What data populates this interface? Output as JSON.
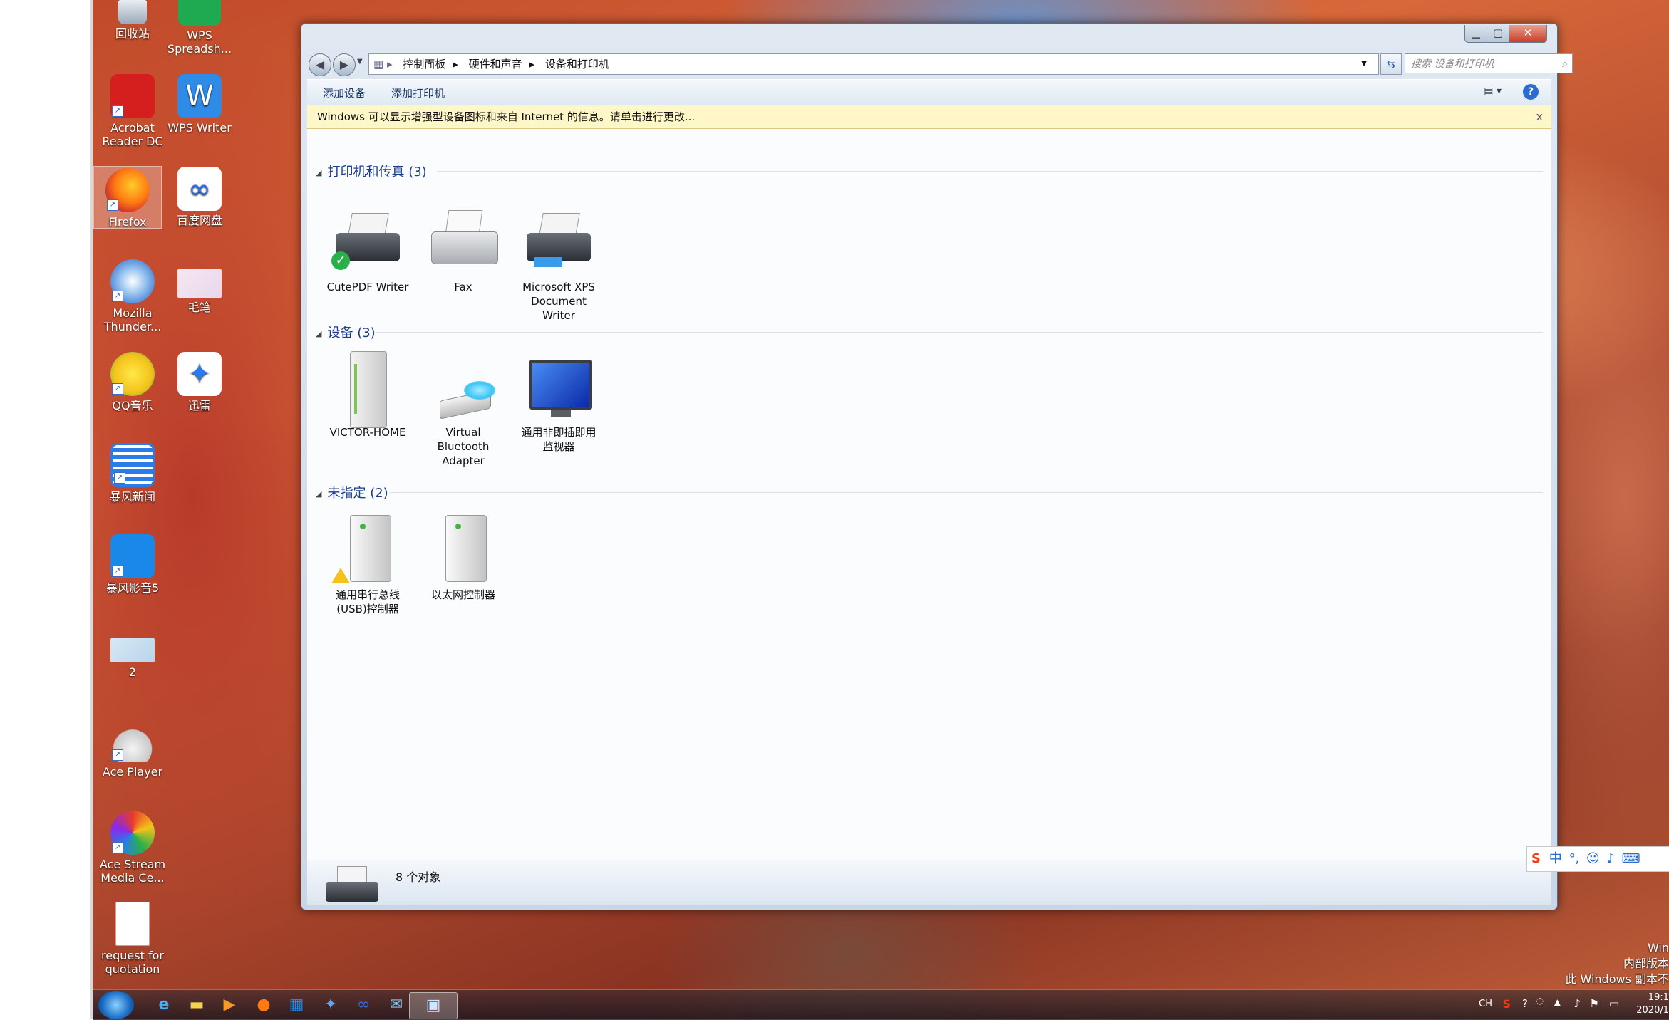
{
  "desktop": {
    "icons": [
      {
        "label": "回收站"
      },
      {
        "label": "WPS\nSpreadsh..."
      },
      {
        "label": "Acrobat\nReader DC"
      },
      {
        "label": "WPS Writer"
      },
      {
        "label": "Firefox"
      },
      {
        "label": "百度网盘"
      },
      {
        "label": "Mozilla\nThunder..."
      },
      {
        "label": "毛笔"
      },
      {
        "label": "QQ音乐"
      },
      {
        "label": "迅雷"
      },
      {
        "label": "暴风新闻"
      },
      {
        "label": "暴风影音5"
      },
      {
        "label": "2"
      },
      {
        "label": "Ace Player"
      },
      {
        "label": "Ace Stream\nMedia Ce..."
      },
      {
        "label": "request for\nquotation"
      }
    ]
  },
  "window": {
    "address": [
      "控制面板",
      "硬件和声音",
      "设备和打印机"
    ],
    "search_placeholder": "搜索 设备和打印机",
    "toolbar": {
      "add_device": "添加设备",
      "add_printer": "添加打印机"
    },
    "infobar": "Windows 可以显示增强型设备图标和来自 Internet 的信息。请单击进行更改...",
    "groups": [
      {
        "header": "打印机和传真 (3)",
        "devices": [
          "CutePDF Writer",
          "Fax",
          "Microsoft XPS\nDocument\nWriter"
        ]
      },
      {
        "header": "设备 (3)",
        "devices": [
          "VICTOR-HOME",
          "Virtual\nBluetooth\nAdapter",
          "通用非即插即用\n监视器"
        ]
      },
      {
        "header": "未指定 (2)",
        "devices": [
          "通用串行总线\n(USB)控制器",
          "以太网控制器"
        ]
      }
    ],
    "details": "8 个对象"
  },
  "taskbar": {
    "tray": {
      "lang": "CH",
      "time": "19:1",
      "date": "2020/1"
    }
  },
  "watermark": [
    "Win",
    "内部版本",
    "此 Windows 副本不"
  ],
  "ime": {
    "label": "中"
  }
}
